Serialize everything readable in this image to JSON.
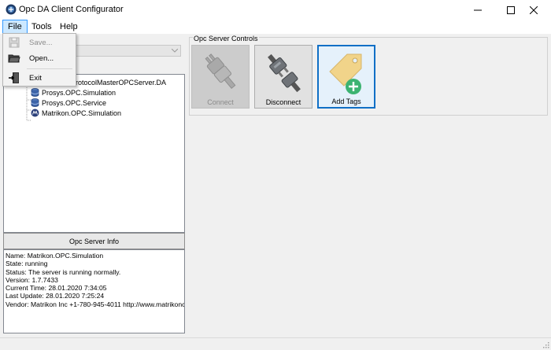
{
  "window": {
    "title": "Opc DA Client Configurator"
  },
  "menu": {
    "file": "File",
    "tools": "Tools",
    "help": "Help"
  },
  "file_menu": {
    "save": "Save...",
    "open": "Open...",
    "exit": "Exit"
  },
  "tree": {
    "items": [
      {
        "label": "-ProtocolMasterOPCServer.DA",
        "icon": "server-icon"
      },
      {
        "label": "Prosys.OPC.Simulation",
        "icon": "database-icon"
      },
      {
        "label": "Prosys.OPC.Service",
        "icon": "database-icon"
      },
      {
        "label": "Matrikon.OPC.Simulation",
        "icon": "matrikon-icon"
      }
    ]
  },
  "info": {
    "header": "Opc Server Info",
    "lines": [
      "Name: Matrikon.OPC.Simulation",
      "State: running",
      "Status: The server is running normally.",
      "Version: 1.7.7433",
      "Current Time: 28.01.2020 7:34:05",
      "Last Update: 28.01.2020 7:25:24",
      "Vendor: Matrikon Inc +1-780-945-4011 http://www.matrikonc"
    ]
  },
  "controls": {
    "group_label": "Opc Server Controls",
    "connect": "Connect",
    "disconnect": "Disconnect",
    "add_tags": "Add Tags"
  },
  "colors": {
    "accent": "#0f6fc6",
    "menu_highlight": "#cce8ff",
    "add_green": "#3cb371"
  }
}
